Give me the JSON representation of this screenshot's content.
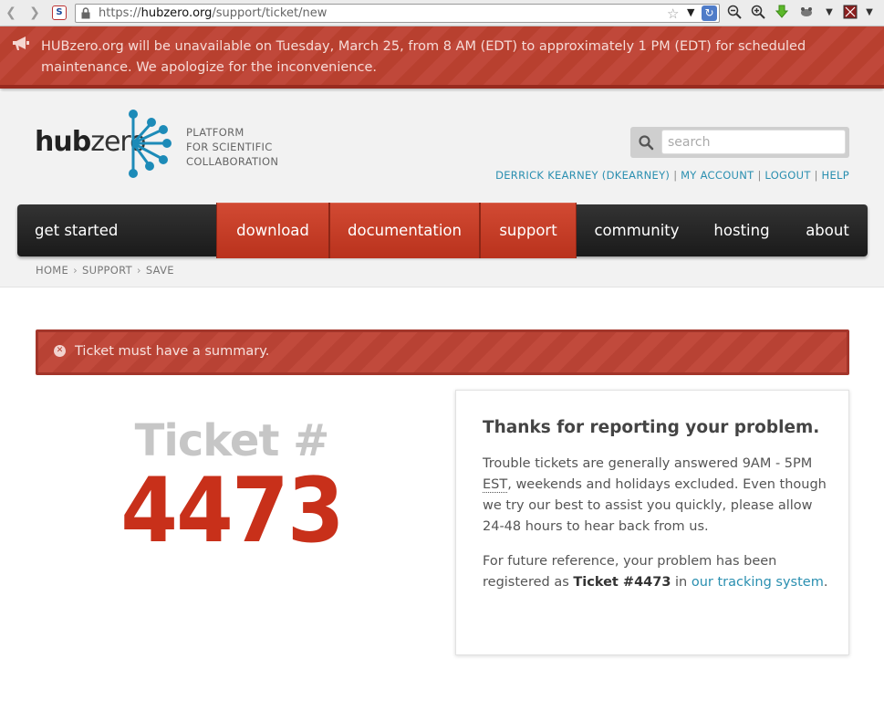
{
  "browser": {
    "url_prefix": "https://",
    "url_host": "hubzero.org",
    "url_path": "/support/ticket/new",
    "site_icon": "S",
    "icons": [
      "back-icon",
      "forward-icon",
      "lock-icon",
      "bookmark-star-icon",
      "reload-icon",
      "zoom-out-icon",
      "zoom-in-icon",
      "download-icon",
      "addon-icon",
      "menu-icon"
    ]
  },
  "alert": {
    "icon": "bullhorn-icon",
    "text": "HUBzero.org will be unavailable on Tuesday, March 25, from 8 AM (EDT) to approximately 1 PM (EDT) for scheduled maintenance. We apologize for the inconvenience."
  },
  "header": {
    "logo_hub": "hub",
    "logo_zero": "zero",
    "tagline": [
      "PLATFORM",
      "FOR SCIENTIFIC",
      "COLLABORATION"
    ],
    "search_placeholder": "search",
    "user_links": {
      "user": "DERRICK KEARNEY (DKEARNEY)",
      "account": "MY ACCOUNT",
      "logout": "LOGOUT",
      "help": "HELP",
      "separator": "|"
    }
  },
  "nav": {
    "get_started": "get started",
    "download": "download",
    "documentation": "documentation",
    "support": "support",
    "community": "community",
    "hosting": "hosting",
    "about": "about"
  },
  "breadcrumb": {
    "home": "HOME",
    "support": "SUPPORT",
    "save": "SAVE",
    "separator": "›"
  },
  "error": {
    "text": "Ticket must have a summary."
  },
  "ticket": {
    "label": "Ticket #",
    "number": "4473"
  },
  "info": {
    "title": "Thanks for reporting your problem.",
    "p1_before": "Trouble tickets are generally answered 9AM - 5PM ",
    "p1_abbr": "EST",
    "p1_after": ", weekends and holidays excluded. Even though we try our best to assist you quickly, please allow 24-48 hours to hear back from us.",
    "p2_before": "For future reference, your problem has been registered as ",
    "p2_ticket": "Ticket #4473",
    "p2_middle": " in ",
    "p2_link": "our tracking system",
    "p2_end": "."
  },
  "colors": {
    "accent_red": "#c8301a",
    "link_blue": "#2a8fb0",
    "logo_blue": "#1d8bb8"
  }
}
